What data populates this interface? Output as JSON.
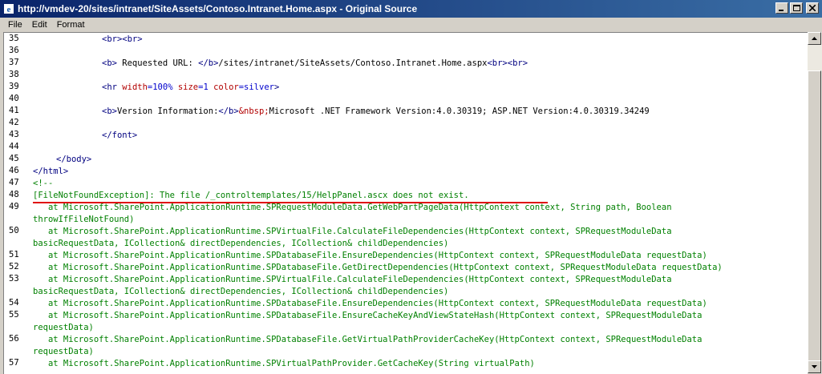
{
  "window": {
    "title": "http://vmdev-20/sites/intranet/SiteAssets/Contoso.Intranet.Home.aspx - Original Source",
    "icon": "ie-page-icon",
    "buttons": [
      "minimize-icon",
      "maximize-icon",
      "close-icon"
    ]
  },
  "menu": {
    "file": "File",
    "edit": "Edit",
    "format": "Format"
  },
  "editor": {
    "line_numbers": {
      "l35": "35",
      "l36": "36",
      "l37": "37",
      "l38": "38",
      "l39": "39",
      "l40": "40",
      "l41": "41",
      "l42": "42",
      "l43": "43",
      "l44": "44",
      "l45": "45",
      "l46": "46",
      "l47": "47",
      "l48": "48",
      "l49": "49",
      "l50": "50",
      "l51": "51",
      "l52": "52",
      "l53": "53",
      "l54": "54",
      "l55": "55",
      "l56": "56",
      "l57": "57"
    },
    "code": {
      "l35": {
        "tag": "<br><br>"
      },
      "l37": {
        "open": "<b>",
        "text1": " Requested URL: ",
        "close": "</b>",
        "text2": "/sites/intranet/SiteAssets/Contoso.Intranet.Home.aspx",
        "tail": "<br><br>"
      },
      "l39": {
        "open": "<hr ",
        "a1": "width",
        "v1": "=100%",
        "a2": " size",
        "v2": "=1",
        "a3": " color",
        "v3": "=silver",
        "close": ">"
      },
      "l41": {
        "open": "<b>",
        "text1": "Version Information:",
        "close": "</b>",
        "entity": "&nbsp;",
        "text2": "Microsoft .NET Framework Version:4.0.30319; ASP.NET Version:4.0.30319.34249"
      },
      "l43": {
        "tag": "</font>"
      },
      "l45": {
        "tag": "</body>"
      },
      "l46": {
        "tag": "</html>"
      },
      "l47": {
        "text": "<!--"
      },
      "l48": {
        "text": "[FileNotFoundException]: The file /_controltemplates/15/HelpPanel.ascx does not exist."
      },
      "l49a": "   at Microsoft.SharePoint.ApplicationRuntime.SPRequestModuleData.GetWebPartPageData(HttpContext context, String path, Boolean",
      "l49b": "throwIfFileNotFound)",
      "l50a": "   at Microsoft.SharePoint.ApplicationRuntime.SPVirtualFile.CalculateFileDependencies(HttpContext context, SPRequestModuleData",
      "l50b": "basicRequestData, ICollection& directDependencies, ICollection& childDependencies)",
      "l51": "   at Microsoft.SharePoint.ApplicationRuntime.SPDatabaseFile.EnsureDependencies(HttpContext context, SPRequestModuleData requestData)",
      "l52": "   at Microsoft.SharePoint.ApplicationRuntime.SPDatabaseFile.GetDirectDependencies(HttpContext context, SPRequestModuleData requestData)",
      "l53a": "   at Microsoft.SharePoint.ApplicationRuntime.SPVirtualFile.CalculateFileDependencies(HttpContext context, SPRequestModuleData",
      "l53b": "basicRequestData, ICollection& directDependencies, ICollection& childDependencies)",
      "l54": "   at Microsoft.SharePoint.ApplicationRuntime.SPDatabaseFile.EnsureDependencies(HttpContext context, SPRequestModuleData requestData)",
      "l55a": "   at Microsoft.SharePoint.ApplicationRuntime.SPDatabaseFile.EnsureCacheKeyAndViewStateHash(HttpContext context, SPRequestModuleData",
      "l55b": "requestData)",
      "l56a": "   at Microsoft.SharePoint.ApplicationRuntime.SPDatabaseFile.GetVirtualPathProviderCacheKey(HttpContext context, SPRequestModuleData",
      "l56b": "requestData)",
      "l57": "   at Microsoft.SharePoint.ApplicationRuntime.SPVirtualPathProvider.GetCacheKey(String virtualPath)"
    }
  },
  "colors": {
    "tag": "#000080",
    "attribute": "#b20000",
    "value": "#0000cc",
    "comment": "#008000",
    "highlight_underline": "#e01010",
    "titlebar": "#0a246a"
  }
}
